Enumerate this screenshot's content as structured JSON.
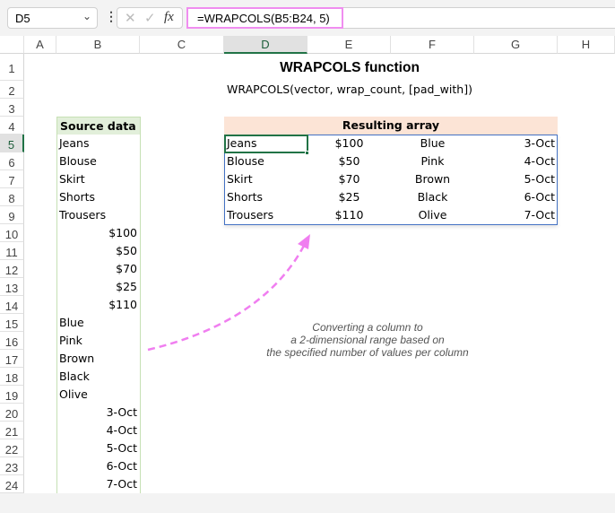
{
  "formula_bar": {
    "name_box": "D5",
    "formula": "=WRAPCOLS(B5:B24, 5)",
    "fx_label": "fx",
    "cancel": "✕",
    "enter": "✓"
  },
  "columns": [
    "A",
    "B",
    "C",
    "D",
    "E",
    "F",
    "G",
    "H"
  ],
  "selected": {
    "column": "D",
    "row": 5
  },
  "rows": [
    1,
    2,
    3,
    4,
    5,
    6,
    7,
    8,
    9,
    10,
    11,
    12,
    13,
    14,
    15,
    16,
    17,
    18,
    19,
    20,
    21,
    22,
    23,
    24
  ],
  "title": "WRAPCOLS function",
  "syntax": "WRAPCOLS(vector, wrap_count, [pad_with])",
  "source": {
    "header": "Source data",
    "values": [
      "Jeans",
      "Blouse",
      "Skirt",
      "Shorts",
      "Trousers",
      "$100",
      "$50",
      "$70",
      "$25",
      "$110",
      "Blue",
      "Pink",
      "Brown",
      "Black",
      "Olive",
      "3-Oct",
      "4-Oct",
      "5-Oct",
      "6-Oct",
      "7-Oct"
    ]
  },
  "result": {
    "header": "Resulting array",
    "rows": [
      [
        "Jeans",
        "$100",
        "Blue",
        "3-Oct"
      ],
      [
        "Blouse",
        "$50",
        "Pink",
        "4-Oct"
      ],
      [
        "Skirt",
        "$70",
        "Brown",
        "5-Oct"
      ],
      [
        "Shorts",
        "$25",
        "Black",
        "6-Oct"
      ],
      [
        "Trousers",
        "$110",
        "Olive",
        "7-Oct"
      ]
    ]
  },
  "annotation": [
    "Converting a column to",
    "a 2-dimensional range based on",
    "the specified number of values per column"
  ],
  "colors": {
    "source_header": "#e2efda",
    "source_border": "#c6e0b4",
    "result_header": "#fce4d6",
    "result_border": "#4472c4",
    "selection": "#217346",
    "arrow": "#f07ef0"
  }
}
